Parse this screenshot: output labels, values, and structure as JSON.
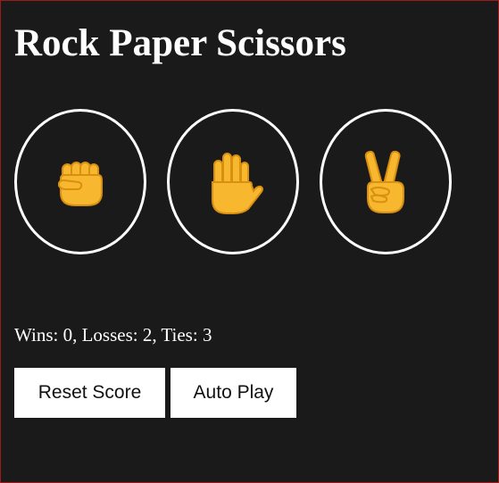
{
  "title": "Rock Paper Scissors",
  "moves": [
    {
      "name": "rock",
      "icon": "raised-fist-emoji"
    },
    {
      "name": "paper",
      "icon": "raised-hand-emoji"
    },
    {
      "name": "scissors",
      "icon": "victory-hand-emoji"
    }
  ],
  "score": {
    "text": "Wins: 0, Losses: 2, Ties: 3",
    "wins": 0,
    "losses": 2,
    "ties": 3
  },
  "buttons": {
    "reset_label": "Reset Score",
    "autoplay_label": "Auto Play"
  },
  "colors": {
    "background": "#1a1a1a",
    "frame_border": "#9e1b1b",
    "text": "#ffffff",
    "emoji_fill": "#f7b82f",
    "emoji_shade": "#e39a17"
  }
}
